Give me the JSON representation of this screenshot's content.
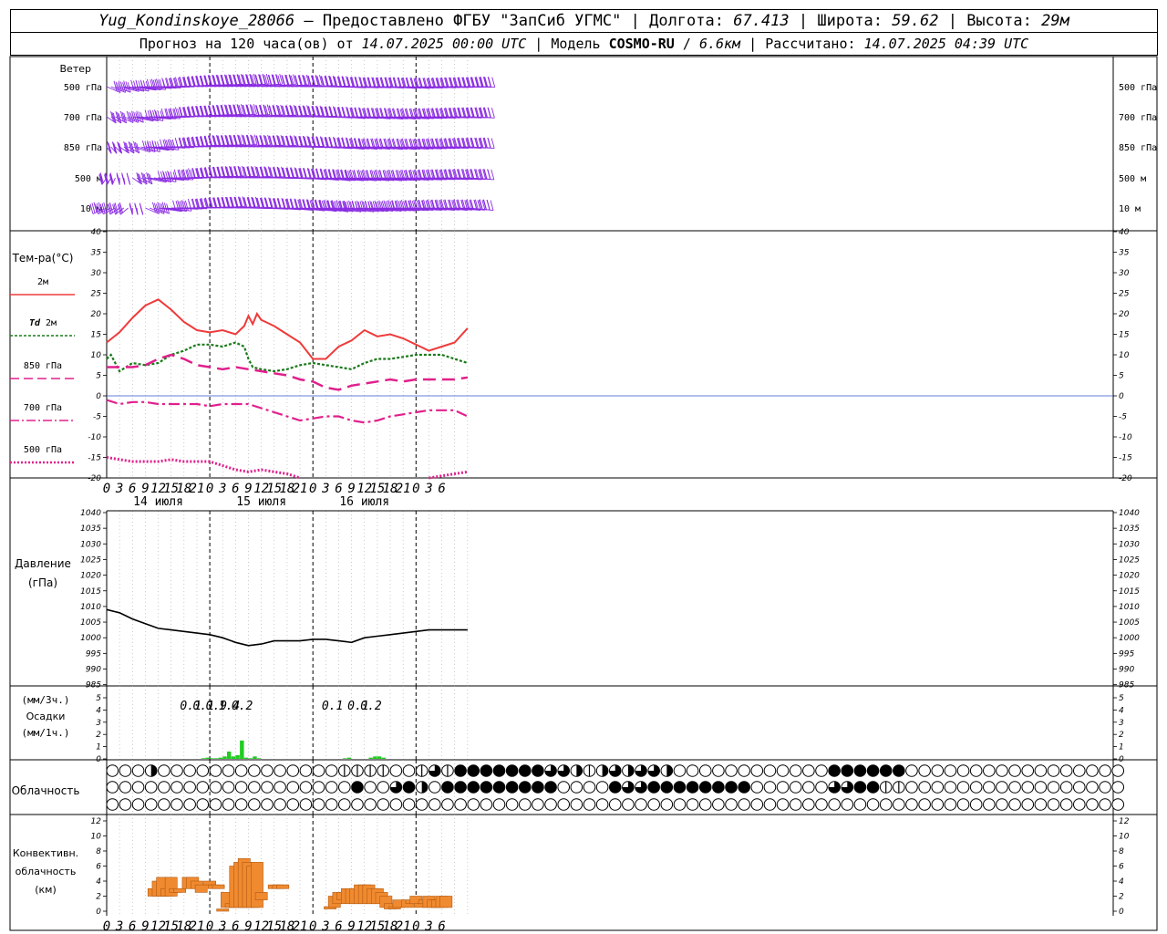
{
  "header": {
    "station": "Yug_Kondinskoye_28066",
    "provider": "– Предоставлено ФГБУ \"ЗапСиб УГМС\"",
    "lon_label": "Долгота:",
    "lon_value": "67.413",
    "lat_label": "Широта:",
    "lat_value": "59.62",
    "alt_label": "Высота:",
    "alt_value": "29м",
    "forecast_label": "Прогноз на 120 часа(ов) от",
    "forecast_start": "14.07.2025 00:00 UTC",
    "model_label": "Модель",
    "model_name": "COSMO-RU",
    "model_res": "6.6км",
    "computed_label": "Рассчитано:",
    "computed_time": "14.07.2025 04:39 UTC"
  },
  "time_axis": {
    "hour_labels": [
      "0",
      "3",
      "6",
      "9",
      "12",
      "15",
      "18",
      "21",
      "0",
      "3",
      "6",
      "9",
      "12",
      "15",
      "18",
      "21",
      "0",
      "3",
      "6",
      "9",
      "12",
      "15",
      "18",
      "21",
      "0",
      "3",
      "6"
    ],
    "day_labels": [
      "14 июля",
      "15 июля",
      "16 июля"
    ]
  },
  "colors": {
    "wind": "#8a2be2",
    "t2m": "#ee3b3b",
    "td2m": "#1a7a1a",
    "t850": "#e0208c",
    "t700": "#e0208c",
    "t500": "#e0208c",
    "pressure": "#000000",
    "precip": "#22cc22",
    "convective": "#f08a30"
  },
  "wind_panel": {
    "title": "Ветер",
    "levels": [
      "500 гПа",
      "700 гПа",
      "850 гПа",
      "500 м",
      "10  м"
    ]
  },
  "temp_panel": {
    "title": "Тем-ра(°C)",
    "legend": {
      "t2m": "2м",
      "td_prefix": "Td",
      "td_suffix": "2м",
      "t850": "850 гПа",
      "t700": "700 гПа",
      "t500": "500 гПа"
    },
    "ticks": [
      "40",
      "35",
      "30",
      "25",
      "20",
      "15",
      "10",
      "5",
      "0",
      "-5",
      "-10",
      "-15",
      "-20"
    ]
  },
  "pressure_panel": {
    "title": "Давление",
    "unit": "(гПа)",
    "ticks": [
      "1040",
      "1035",
      "1030",
      "1025",
      "1020",
      "1015",
      "1010",
      "1005",
      "1000",
      "995",
      "990",
      "985"
    ]
  },
  "precip_panel": {
    "unit3h": "(мм/3ч.)",
    "title": "Осадки",
    "unit1h": "(мм/1ч.)",
    "ticks": [
      "5",
      "4",
      "3",
      "2",
      "1",
      "0"
    ],
    "labels": [
      {
        "hour": 24,
        "text": "0.1"
      },
      {
        "hour": 27,
        "text": "0.1"
      },
      {
        "hour": 30,
        "text": "0.9"
      },
      {
        "hour": 33,
        "text": "1.4"
      },
      {
        "hour": 36,
        "text": "0.2"
      },
      {
        "hour": 57,
        "text": "0.1"
      },
      {
        "hour": 63,
        "text": "0.1"
      },
      {
        "hour": 66,
        "text": "0.2"
      }
    ]
  },
  "cloud_panel": {
    "title": "Облачность",
    "rows": [
      "00020000000000000011110013144444443321232332000000000000444444000000000000000000001433444444441123302342111111110000000000000000",
      "00000000000000000004003420444444444000043344444444000000334411000000000000000000000000000000000000000000000000000000000000000000",
      "00000000000000000000000000000000000000000000000000000000000000000000000000000000000000000000000000000000000000000000000000000000"
    ]
  },
  "conv_panel": {
    "title1": "Конвективн.",
    "title2": "облачность",
    "unit": "(км)",
    "ticks": [
      "12",
      "10",
      "8",
      "6",
      "4",
      "2",
      "0"
    ]
  },
  "chart_data": [
    {
      "type": "line",
      "title": "Тем-ра(°C)",
      "x_unit": "hours from 14.07.2025 00:00 UTC",
      "ylim": [
        -20,
        40
      ],
      "series": [
        {
          "name": "2м",
          "x": [
            0,
            3,
            6,
            9,
            12,
            15,
            18,
            21,
            24,
            27,
            30,
            32,
            33,
            34,
            35,
            36,
            37,
            39,
            42,
            45,
            48,
            51,
            54,
            57,
            60,
            63,
            66,
            69,
            72,
            75,
            78,
            81,
            84
          ],
          "y": [
            13,
            15.5,
            19,
            22,
            23.5,
            21,
            18,
            16,
            15.5,
            16,
            15,
            17,
            19.5,
            17.5,
            20,
            18.5,
            18,
            17,
            15,
            13,
            9,
            9,
            12,
            13.5,
            16,
            14.5,
            15,
            14,
            12.5,
            11,
            12,
            13,
            16.5
          ]
        },
        {
          "name": "Td 2м",
          "x": [
            0,
            1,
            3,
            6,
            9,
            12,
            15,
            18,
            21,
            24,
            27,
            30,
            32,
            33,
            34,
            36,
            39,
            42,
            45,
            48,
            51,
            54,
            57,
            60,
            63,
            66,
            69,
            72,
            75,
            78,
            81,
            84
          ],
          "y": [
            9,
            10,
            6,
            8,
            7.5,
            8,
            10,
            11,
            12.5,
            12.5,
            12,
            13,
            12,
            9,
            7,
            6.5,
            6,
            6.5,
            7.5,
            8,
            7.5,
            7,
            6.5,
            8,
            9,
            9,
            9.5,
            10,
            10,
            10,
            9,
            8
          ]
        },
        {
          "name": "850 гПа",
          "x": [
            0,
            3,
            6,
            9,
            12,
            15,
            18,
            21,
            24,
            27,
            30,
            33,
            36,
            39,
            42,
            45,
            48,
            51,
            54,
            57,
            60,
            63,
            66,
            69,
            72,
            75,
            78,
            81,
            84
          ],
          "y": [
            7,
            7,
            7,
            7.5,
            9,
            10,
            9,
            7.5,
            7,
            6.5,
            7,
            6.5,
            6,
            5.5,
            5,
            4,
            3.5,
            2,
            1.5,
            2.5,
            3,
            3.5,
            4,
            3.5,
            4,
            4,
            4,
            4,
            4.5
          ]
        },
        {
          "name": "700 гПа",
          "x": [
            0,
            3,
            6,
            9,
            12,
            15,
            18,
            21,
            24,
            27,
            30,
            33,
            36,
            39,
            42,
            45,
            48,
            51,
            54,
            57,
            60,
            63,
            66,
            69,
            72,
            75,
            78,
            81,
            84
          ],
          "y": [
            -1,
            -2,
            -1.5,
            -1.5,
            -2,
            -2,
            -2,
            -2,
            -2.5,
            -2,
            -2,
            -2,
            -3,
            -4,
            -5,
            -6,
            -5.5,
            -5,
            -5,
            -6,
            -6.5,
            -6,
            -5,
            -4.5,
            -4,
            -3.5,
            -3.5,
            -3.5,
            -5
          ]
        },
        {
          "name": "500 гПа",
          "x": [
            0,
            3,
            6,
            9,
            12,
            15,
            18,
            21,
            24,
            27,
            30,
            33,
            36,
            39,
            42,
            45,
            48,
            51,
            54,
            57,
            60,
            63,
            66,
            69,
            72,
            75,
            78,
            81,
            84
          ],
          "y": [
            -15,
            -15.5,
            -16,
            -16,
            -16,
            -15.5,
            -16,
            -16,
            -16,
            -17,
            -18,
            -18.5,
            -18,
            -18.5,
            -19,
            -20,
            null,
            null,
            null,
            null,
            null,
            null,
            null,
            null,
            null,
            -20,
            -19.5,
            -19,
            -18.5
          ]
        }
      ]
    },
    {
      "type": "line",
      "title": "Давление",
      "ylabel": "(гПа)",
      "ylim": [
        985,
        1040
      ],
      "series": [
        {
          "name": "Давление",
          "x": [
            0,
            3,
            6,
            9,
            12,
            15,
            18,
            21,
            24,
            27,
            30,
            33,
            36,
            39,
            42,
            45,
            48,
            51,
            54,
            57,
            60,
            63,
            66,
            69,
            72,
            75,
            78,
            81,
            84
          ],
          "y": [
            1009,
            1008,
            1006,
            1004.5,
            1003,
            1002.5,
            1002,
            1001.5,
            1001,
            1000,
            998.5,
            997.5,
            998,
            999,
            999,
            999,
            999.5,
            999.5,
            999,
            998.5,
            1000,
            1000.5,
            1001,
            1001.5,
            1002,
            1002.5,
            1002.5,
            1002.5,
            1002.5
          ]
        }
      ]
    },
    {
      "type": "bar",
      "title": "Осадки",
      "ylabel": "(мм/1ч.)",
      "ylim": [
        0,
        5
      ],
      "x": [
        23,
        24,
        25,
        26,
        27,
        28,
        29,
        30,
        31,
        32,
        33,
        34,
        35,
        36,
        56,
        57,
        62,
        63,
        64,
        65
      ],
      "values": [
        0.05,
        0.1,
        0.05,
        0.05,
        0.1,
        0.2,
        0.6,
        0.2,
        0.3,
        1.5,
        0.1,
        0.05,
        0.2,
        0.05,
        0.05,
        0.1,
        0.1,
        0.2,
        0.2,
        0.1
      ]
    },
    {
      "type": "bar",
      "title": "Конвективн. облачность",
      "ylabel": "(км)",
      "ylim": [
        0,
        13
      ],
      "segments": [
        {
          "x": 11,
          "lo": 2,
          "hi": 3
        },
        {
          "x": 12,
          "lo": 2,
          "hi": 4
        },
        {
          "x": 13,
          "lo": 2,
          "hi": 4.5
        },
        {
          "x": 14,
          "lo": 2,
          "hi": 3
        },
        {
          "x": 15,
          "lo": 2,
          "hi": 4.5
        },
        {
          "x": 16,
          "lo": 2.5,
          "hi": 3
        },
        {
          "x": 17,
          "lo": 2.5,
          "hi": 3
        },
        {
          "x": 19,
          "lo": 3,
          "hi": 4.5
        },
        {
          "x": 20,
          "lo": 3,
          "hi": 4.5
        },
        {
          "x": 21,
          "lo": 3,
          "hi": 4
        },
        {
          "x": 22,
          "lo": 2.5,
          "hi": 3.5
        },
        {
          "x": 24,
          "lo": 3.5,
          "hi": 4
        },
        {
          "x": 25,
          "lo": 3,
          "hi": 3.5
        },
        {
          "x": 26,
          "lo": 3,
          "hi": 3.5
        },
        {
          "x": 27,
          "lo": 0,
          "hi": 0.3
        },
        {
          "x": 28,
          "lo": 0.5,
          "hi": 2.5
        },
        {
          "x": 29,
          "lo": 0.5,
          "hi": 1
        },
        {
          "x": 30,
          "lo": 0.5,
          "hi": 6
        },
        {
          "x": 31,
          "lo": 0.5,
          "hi": 6.5
        },
        {
          "x": 32,
          "lo": 0.5,
          "hi": 7
        },
        {
          "x": 33,
          "lo": 0.5,
          "hi": 6.5
        },
        {
          "x": 34,
          "lo": 0.5,
          "hi": 6
        },
        {
          "x": 35,
          "lo": 0.5,
          "hi": 6.5
        },
        {
          "x": 36,
          "lo": 1.5,
          "hi": 2.5
        },
        {
          "x": 39,
          "lo": 3,
          "hi": 3.5
        },
        {
          "x": 40,
          "lo": 3,
          "hi": 3.5
        },
        {
          "x": 41,
          "lo": 3,
          "hi": 3.5
        },
        {
          "x": 52,
          "lo": 0.3,
          "hi": 0.6
        },
        {
          "x": 53,
          "lo": 0.5,
          "hi": 2
        },
        {
          "x": 54,
          "lo": 1,
          "hi": 2.5
        },
        {
          "x": 55,
          "lo": 1.5,
          "hi": 2.5
        },
        {
          "x": 56,
          "lo": 1,
          "hi": 3
        },
        {
          "x": 57,
          "lo": 1,
          "hi": 3
        },
        {
          "x": 58,
          "lo": 1,
          "hi": 3
        },
        {
          "x": 59,
          "lo": 1,
          "hi": 3.5
        },
        {
          "x": 60,
          "lo": 1,
          "hi": 3.5
        },
        {
          "x": 61,
          "lo": 1,
          "hi": 3.5
        },
        {
          "x": 62,
          "lo": 1,
          "hi": 3
        },
        {
          "x": 63,
          "lo": 1,
          "hi": 3
        },
        {
          "x": 64,
          "lo": 1,
          "hi": 2.5
        },
        {
          "x": 65,
          "lo": 0.5,
          "hi": 2
        },
        {
          "x": 66,
          "lo": 0.3,
          "hi": 1
        },
        {
          "x": 67,
          "lo": 0.3,
          "hi": 0.6
        },
        {
          "x": 68,
          "lo": 0.5,
          "hi": 1.5
        },
        {
          "x": 70,
          "lo": 0.5,
          "hi": 1.5
        },
        {
          "x": 71,
          "lo": 1,
          "hi": 1.5
        },
        {
          "x": 72,
          "lo": 1,
          "hi": 2
        },
        {
          "x": 73,
          "lo": 0.5,
          "hi": 1
        },
        {
          "x": 74,
          "lo": 1,
          "hi": 1.5
        },
        {
          "x": 75,
          "lo": 0.5,
          "hi": 2
        },
        {
          "x": 76,
          "lo": 0.5,
          "hi": 1.5
        },
        {
          "x": 77,
          "lo": 0.5,
          "hi": 1.5
        },
        {
          "x": 78,
          "lo": 0.5,
          "hi": 2
        },
        {
          "x": 79,
          "lo": 0.5,
          "hi": 2
        }
      ]
    }
  ]
}
